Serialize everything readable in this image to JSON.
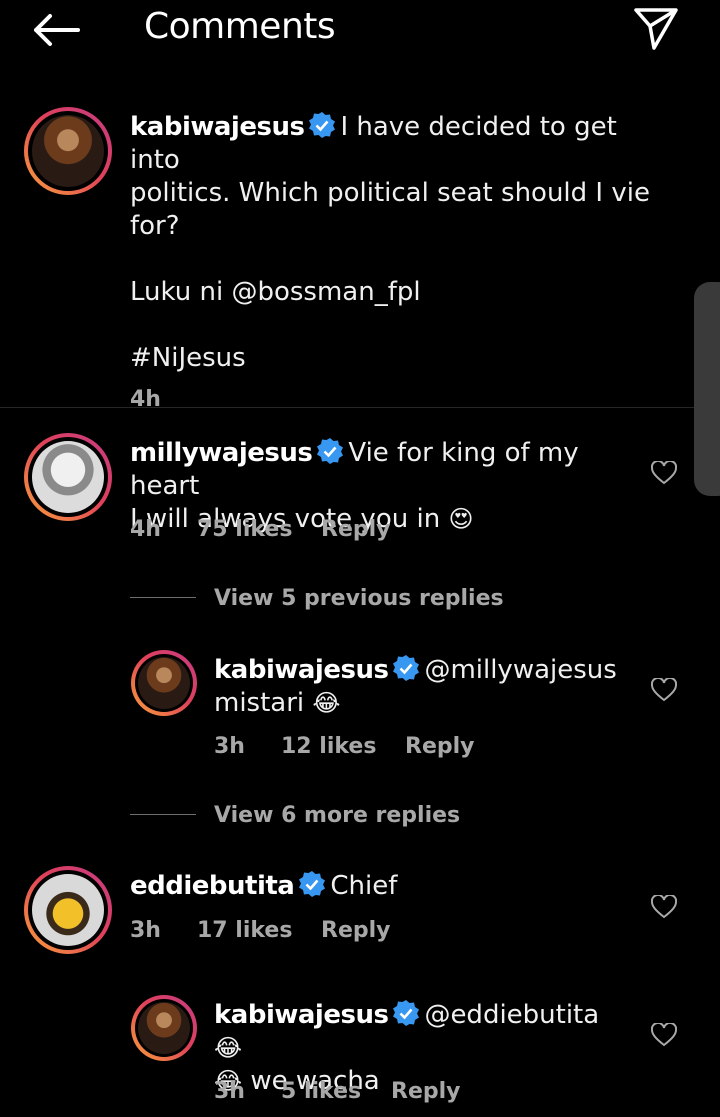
{
  "header": {
    "title": "Comments"
  },
  "caption": {
    "username": "kabiwajesus",
    "line1": "I have decided to get into",
    "line2": "politics. Which political seat should I vie",
    "line3": "for?",
    "line4": "Luku ni @bossman_fpl",
    "line5": "#NiJesus",
    "time": "4h"
  },
  "comments": [
    {
      "username": "millywajesus",
      "line1": "Vie for king of my heart",
      "line2": "I will always vote you in",
      "emoji": "😍",
      "time": "4h",
      "likes": "75 likes",
      "reply": "Reply"
    },
    {
      "view_replies": "View 5 previous replies"
    },
    {
      "username": "kabiwajesus",
      "line1": "@millywajesus",
      "line2": "mistari",
      "emoji": "😂",
      "time": "3h",
      "likes": "12 likes",
      "reply": "Reply"
    },
    {
      "view_replies": "View 6 more replies"
    },
    {
      "username": "eddiebutita",
      "line1": "Chief",
      "time": "3h",
      "likes": "17 likes",
      "reply": "Reply"
    },
    {
      "username": "kabiwajesus",
      "line1": "@eddiebutita",
      "emoji1": "😂",
      "emoji2": "😂",
      "line2": "we wacha",
      "time": "3h",
      "likes": "5 likes",
      "reply": "Reply"
    }
  ],
  "colors": {
    "verified": "#3897f0",
    "ring_start": "#f9a23a",
    "ring_end": "#c43b86"
  }
}
